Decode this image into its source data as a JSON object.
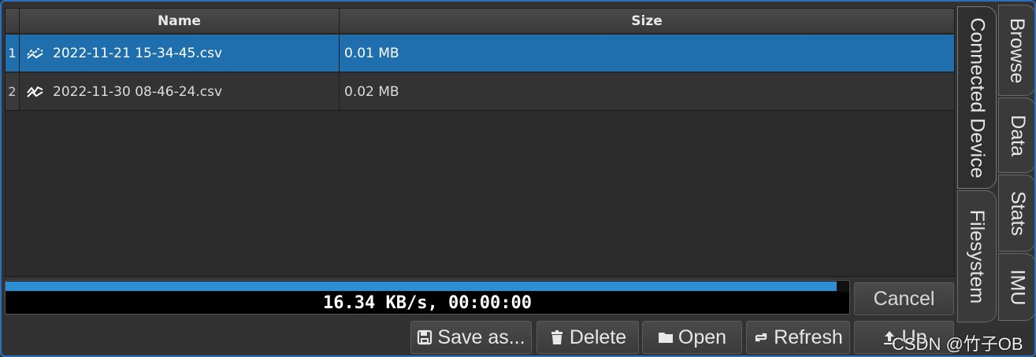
{
  "table": {
    "headers": {
      "name": "Name",
      "size": "Size"
    },
    "rows": [
      {
        "index": "1",
        "name": "2022-11-21 15-34-45.csv",
        "size": "0.01 MB",
        "selected": true,
        "icon": "chart-line-icon"
      },
      {
        "index": "2",
        "name": "2022-11-30 08-46-24.csv",
        "size": "0.02 MB",
        "selected": false,
        "icon": "chart-line-icon"
      }
    ]
  },
  "progress": {
    "fraction": 0.985,
    "text": "16.34 KB/s, 00:00:00",
    "fill_color": "#2e8ed1"
  },
  "buttons": {
    "cancel": "Cancel",
    "save_as": "Save as...",
    "delete": "Delete",
    "open": "Open",
    "refresh": "Refresh",
    "up": "Up"
  },
  "tabs": {
    "inner": [
      "Connected Device",
      "Filesystem"
    ],
    "outer": [
      "Browse",
      "Data",
      "Stats",
      "IMU"
    ]
  },
  "watermark": "CSDN @竹子OB",
  "colors": {
    "accent": "#1f6fae",
    "frame": "#2b6fbf"
  }
}
